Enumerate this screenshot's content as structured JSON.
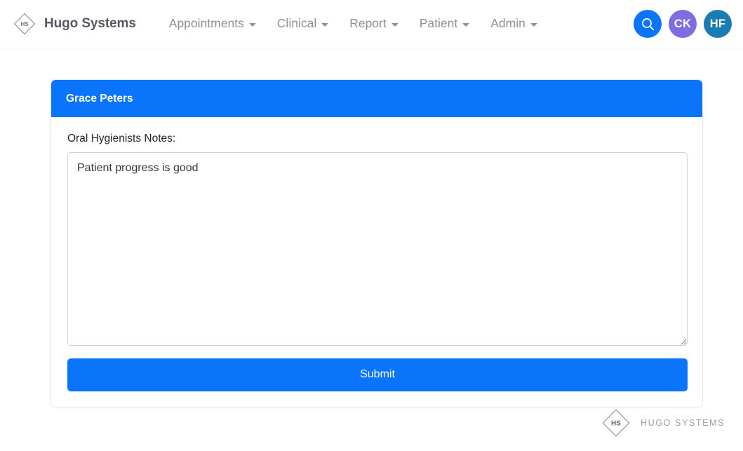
{
  "navbar": {
    "brand": {
      "name": "Hugo Systems",
      "logo_initials": "HS",
      "logo_icon": "diamond-logo-icon"
    },
    "links": [
      {
        "label": "Appointments",
        "icon": "chevron-down-icon"
      },
      {
        "label": "Clinical",
        "icon": "chevron-down-icon"
      },
      {
        "label": "Report",
        "icon": "chevron-down-icon"
      },
      {
        "label": "Patient",
        "icon": "chevron-down-icon"
      },
      {
        "label": "Admin",
        "icon": "chevron-down-icon"
      }
    ],
    "search": {
      "icon": "search-icon",
      "color": "#0a74fb"
    },
    "avatars": [
      {
        "initials": "CK",
        "color": "#7f6ce0"
      },
      {
        "initials": "HF",
        "color": "#1b7cb3"
      }
    ]
  },
  "card": {
    "header_title": "Grace Peters",
    "header_color": "#0a74fb",
    "notes_label": "Oral Hygienists Notes:",
    "notes_value": "Patient progress is good",
    "notes_placeholder": "",
    "submit_label": "Submit",
    "submit_color": "#0a74fb"
  },
  "footer": {
    "logo_initials": "HS",
    "logo_icon": "diamond-logo-icon",
    "text": "HUGO SYSTEMS"
  }
}
